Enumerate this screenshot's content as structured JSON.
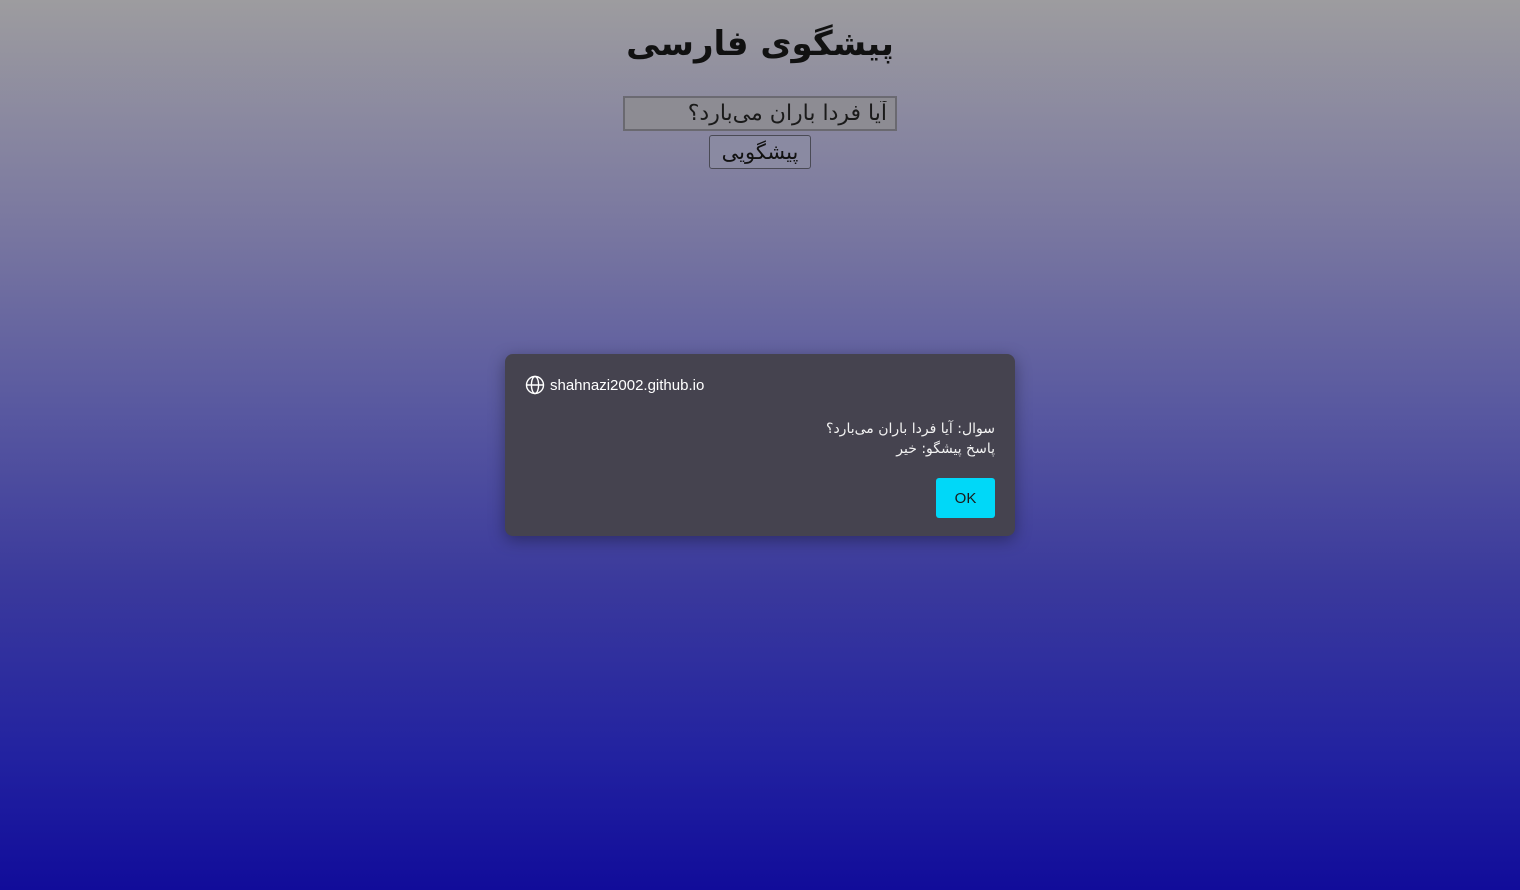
{
  "page": {
    "title": "پیشگوی فارسی"
  },
  "form": {
    "question_value": "آیا فردا باران می‌بارد؟",
    "predict_label": "پیشگویی"
  },
  "dialog": {
    "origin": "shahnazi2002.github.io",
    "line1": "سوال: آیا فردا باران می‌بارد؟",
    "line2": "پاسخ پیشگو: خیر",
    "ok_label": "OK",
    "origin_icon": "globe-icon"
  },
  "colors": {
    "ok_button": "#00d8f8",
    "dialog_bg": "#45434f"
  }
}
